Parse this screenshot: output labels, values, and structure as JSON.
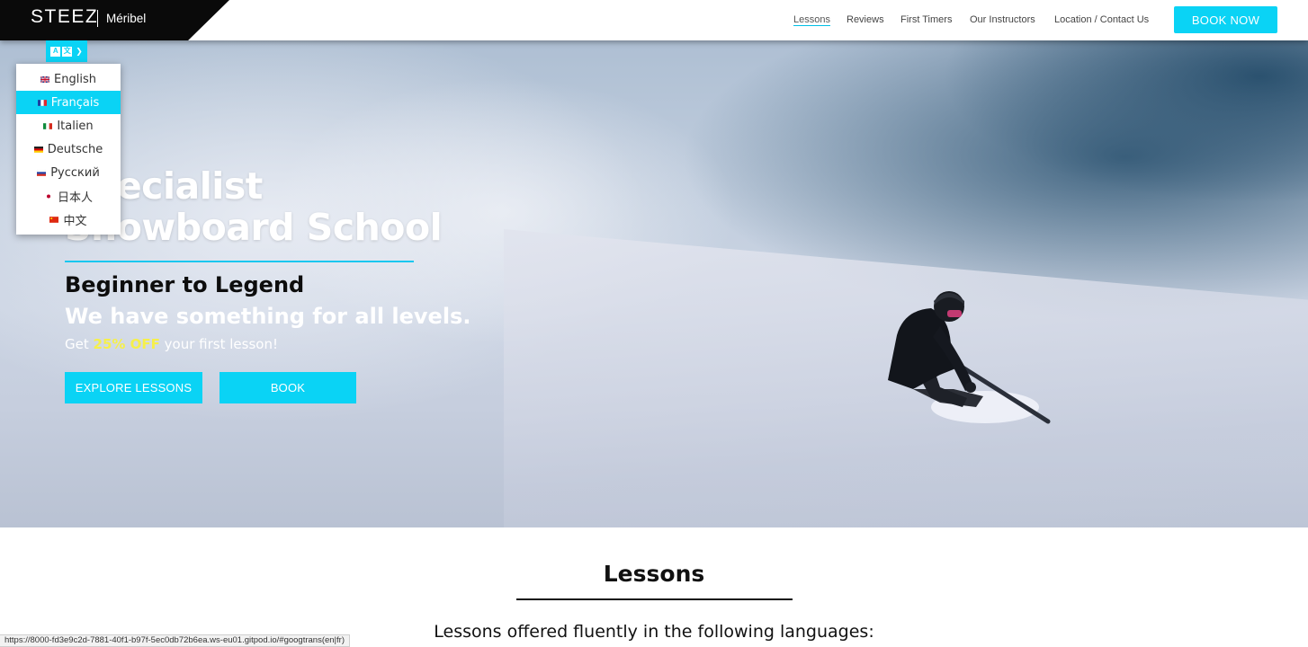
{
  "brand": {
    "name": "STEEZ",
    "location": "Méribel"
  },
  "nav": {
    "items": [
      {
        "label": "Lessons",
        "active": true
      },
      {
        "label": "Reviews",
        "active": false
      },
      {
        "label": "First Timers",
        "active": false
      },
      {
        "label": "Our Instructors",
        "active": false
      },
      {
        "label": "Location / Contact Us",
        "active": false
      }
    ],
    "book_now": "BOOK NOW"
  },
  "language": {
    "toggle_icon": "translate-icon",
    "glyph_a": "A",
    "glyph_b": "文",
    "options": [
      {
        "label": "English",
        "flag": "uk-flag-icon",
        "selected": false
      },
      {
        "label": "Français",
        "flag": "france-flag-icon",
        "selected": true
      },
      {
        "label": "Italien",
        "flag": "italy-flag-icon",
        "selected": false
      },
      {
        "label": "Deutsche",
        "flag": "germany-flag-icon",
        "selected": false
      },
      {
        "label": "Русский",
        "flag": "russia-flag-icon",
        "selected": false
      },
      {
        "label": "日本人",
        "flag": "japan-flag-icon",
        "selected": false
      },
      {
        "label": "中文",
        "flag": "china-flag-icon",
        "selected": false
      }
    ]
  },
  "hero": {
    "title_line1": "Specialist",
    "title_line2": "Snowboard School",
    "tagline": "Beginner to Legend",
    "subtitle": "We have something for all levels.",
    "offer_prefix": "Get ",
    "offer_highlight": "25% OFF",
    "offer_suffix": " your first lesson!",
    "explore_button": "EXPLORE LESSONS",
    "book_button": "BOOK"
  },
  "lessons": {
    "heading": "Lessons",
    "languages_text": "Lessons offered fluently in the following languages:"
  },
  "status_bar": {
    "url": "https://8000-fd3e9c2d-7881-40f1-b97f-5ec0db72b6ea.ws-eu01.gitpod.io/#googtrans(en|fr)"
  },
  "colors": {
    "accent": "#0ad3f5",
    "highlight": "#f6f04a",
    "brand_bg": "#0a0a0a"
  }
}
